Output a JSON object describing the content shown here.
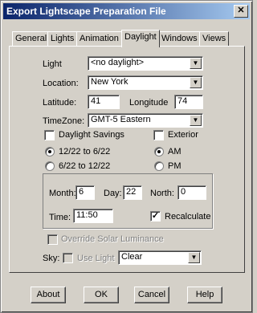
{
  "window": {
    "title": "Export Lightscape Preparation File",
    "close_glyph": "✕"
  },
  "tabs": [
    {
      "label": "General"
    },
    {
      "label": "Lights"
    },
    {
      "label": "Animation"
    },
    {
      "label": "Daylight"
    },
    {
      "label": "Windows"
    },
    {
      "label": "Views"
    }
  ],
  "active_tab": "Daylight",
  "form": {
    "light_label": "Light",
    "light_value": "<no daylight>",
    "location_label": "Location:",
    "location_value": "New York",
    "latitude_label": "Latitude:",
    "latitude_value": "41",
    "longitude_label": "Longitude",
    "longitude_value": "74",
    "timezone_label": "TimeZone:",
    "timezone_value": "GMT-5 Eastern",
    "daylight_savings_label": "Daylight Savings",
    "daylight_savings_checked": false,
    "exterior_label": "Exterior",
    "exterior_checked": false,
    "range1_label": "12/22 to 6/22",
    "range1_selected": true,
    "range2_label": "6/22 to 12/22",
    "range2_selected": false,
    "am_label": "AM",
    "am_selected": true,
    "pm_label": "PM",
    "pm_selected": false
  },
  "datetime": {
    "month_label": "Month:",
    "month_value": "6",
    "day_label": "Day:",
    "day_value": "22",
    "north_label": "North:",
    "north_value": "0",
    "time_label": "Time:",
    "time_value": "11:50",
    "recalculate_label": "Recalculate",
    "recalculate_checked": true
  },
  "override_solar_label": "Override Solar Luminance",
  "sky": {
    "label": "Sky:",
    "use_light_label": "Use Light",
    "value": "Clear"
  },
  "buttons": {
    "about": "About",
    "ok": "OK",
    "cancel": "Cancel",
    "help": "Help"
  },
  "check_glyph": "✓",
  "arrow_glyph": "▼"
}
